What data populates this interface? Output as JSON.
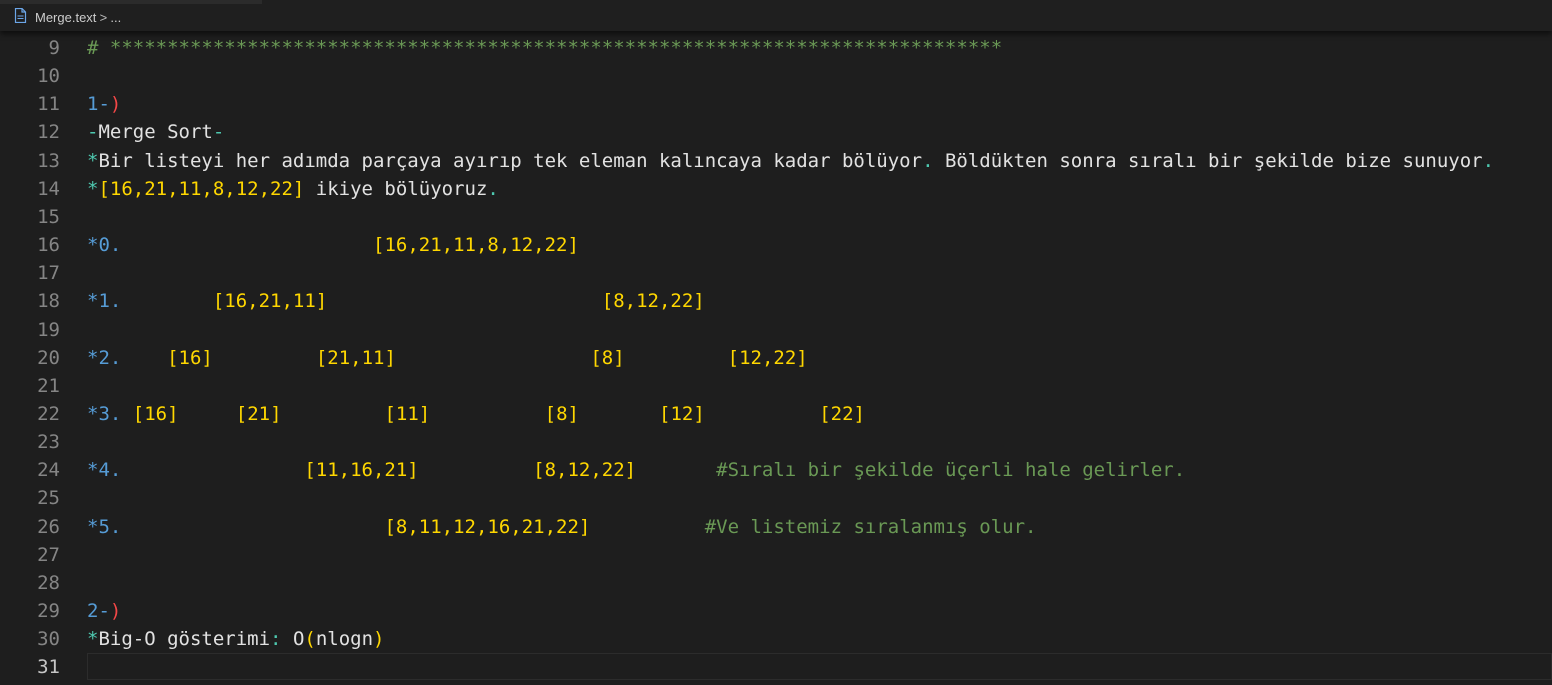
{
  "breadcrumb": {
    "file_name": "Merge.text",
    "separator": ">",
    "more": "...",
    "file_icon": "file-icon"
  },
  "editor": {
    "active_line": 31,
    "lines": [
      {
        "num": "9",
        "tokens": [
          {
            "t": "# ",
            "c": "green"
          },
          {
            "t": "******************************************************************************",
            "c": "green"
          }
        ]
      },
      {
        "num": "10",
        "tokens": []
      },
      {
        "num": "11",
        "tokens": [
          {
            "t": "1-",
            "c": "blue"
          },
          {
            "t": ")",
            "c": "red"
          }
        ]
      },
      {
        "num": "12",
        "tokens": [
          {
            "t": "-",
            "c": "cyan"
          },
          {
            "t": "Merge Sort",
            "c": "white"
          },
          {
            "t": "-",
            "c": "cyan"
          }
        ]
      },
      {
        "num": "13",
        "tokens": [
          {
            "t": "*",
            "c": "cyan"
          },
          {
            "t": "Bir listeyi her adımda parçaya ayırıp tek eleman kalıncaya kadar bölüyor",
            "c": "white"
          },
          {
            "t": ". ",
            "c": "cyan"
          },
          {
            "t": "Böldükten sonra sıralı bir şekilde bize sunuyor",
            "c": "white"
          },
          {
            "t": ".",
            "c": "cyan"
          }
        ]
      },
      {
        "num": "14",
        "tokens": [
          {
            "t": "*",
            "c": "cyan"
          },
          {
            "t": "[16,21,11,8,12,22]",
            "c": "yellow"
          },
          {
            "t": " ikiye bölüyoruz",
            "c": "white"
          },
          {
            "t": ".",
            "c": "cyan"
          }
        ]
      },
      {
        "num": "15",
        "tokens": []
      },
      {
        "num": "16",
        "tokens": [
          {
            "t": "*0.",
            "c": "blue"
          },
          {
            "t": "                      ",
            "c": "white"
          },
          {
            "t": "[16,21,11,8,12,22]",
            "c": "yellow"
          }
        ]
      },
      {
        "num": "17",
        "tokens": []
      },
      {
        "num": "18",
        "tokens": [
          {
            "t": "*1.",
            "c": "blue"
          },
          {
            "t": "        ",
            "c": "white"
          },
          {
            "t": "[16,21,11]",
            "c": "yellow"
          },
          {
            "t": "                        ",
            "c": "white"
          },
          {
            "t": "[8,12,22]",
            "c": "yellow"
          }
        ]
      },
      {
        "num": "19",
        "tokens": []
      },
      {
        "num": "20",
        "tokens": [
          {
            "t": "*2.",
            "c": "blue"
          },
          {
            "t": "    ",
            "c": "white"
          },
          {
            "t": "[16]",
            "c": "yellow"
          },
          {
            "t": "         ",
            "c": "white"
          },
          {
            "t": "[21,11]",
            "c": "yellow"
          },
          {
            "t": "                 ",
            "c": "white"
          },
          {
            "t": "[8]",
            "c": "yellow"
          },
          {
            "t": "         ",
            "c": "white"
          },
          {
            "t": "[12,22]",
            "c": "yellow"
          }
        ]
      },
      {
        "num": "21",
        "tokens": []
      },
      {
        "num": "22",
        "tokens": [
          {
            "t": "*3.",
            "c": "blue"
          },
          {
            "t": " ",
            "c": "white"
          },
          {
            "t": "[16]",
            "c": "yellow"
          },
          {
            "t": "     ",
            "c": "white"
          },
          {
            "t": "[21]",
            "c": "yellow"
          },
          {
            "t": "         ",
            "c": "white"
          },
          {
            "t": "[11]",
            "c": "yellow"
          },
          {
            "t": "          ",
            "c": "white"
          },
          {
            "t": "[8]",
            "c": "yellow"
          },
          {
            "t": "       ",
            "c": "white"
          },
          {
            "t": "[12]",
            "c": "yellow"
          },
          {
            "t": "          ",
            "c": "white"
          },
          {
            "t": "[22]",
            "c": "yellow"
          }
        ]
      },
      {
        "num": "23",
        "tokens": []
      },
      {
        "num": "24",
        "tokens": [
          {
            "t": "*4.",
            "c": "blue"
          },
          {
            "t": "                ",
            "c": "white"
          },
          {
            "t": "[11,16,21]",
            "c": "yellow"
          },
          {
            "t": "          ",
            "c": "white"
          },
          {
            "t": "[8,12,22]",
            "c": "yellow"
          },
          {
            "t": "       ",
            "c": "white"
          },
          {
            "t": "#Sıralı bir şekilde üçerli hale gelirler.",
            "c": "green"
          }
        ]
      },
      {
        "num": "25",
        "tokens": []
      },
      {
        "num": "26",
        "tokens": [
          {
            "t": "*5.",
            "c": "blue"
          },
          {
            "t": "                       ",
            "c": "white"
          },
          {
            "t": "[8,11,12,16,21,22]",
            "c": "yellow"
          },
          {
            "t": "          ",
            "c": "white"
          },
          {
            "t": "#Ve listemiz sıralanmış olur.",
            "c": "green"
          }
        ]
      },
      {
        "num": "27",
        "tokens": []
      },
      {
        "num": "28",
        "tokens": []
      },
      {
        "num": "29",
        "tokens": [
          {
            "t": "2-",
            "c": "blue"
          },
          {
            "t": ")",
            "c": "red"
          }
        ]
      },
      {
        "num": "30",
        "tokens": [
          {
            "t": "*",
            "c": "cyan"
          },
          {
            "t": "Big-O gösterimi",
            "c": "white"
          },
          {
            "t": ": ",
            "c": "cyan"
          },
          {
            "t": "O",
            "c": "white"
          },
          {
            "t": "(",
            "c": "yellow"
          },
          {
            "t": "nlogn",
            "c": "white"
          },
          {
            "t": ")",
            "c": "yellow"
          }
        ]
      },
      {
        "num": "31",
        "tokens": []
      }
    ]
  },
  "colors": {
    "background": "#1e1e1e",
    "line_number": "#858585",
    "line_number_active": "#c6c6c6",
    "text": "#e2e2e2",
    "punctuation": "#4ec9b0",
    "number_prefix": "#569cd6",
    "paren": "#f44747",
    "bracket": "#ffd700",
    "comment": "#6a9955"
  }
}
